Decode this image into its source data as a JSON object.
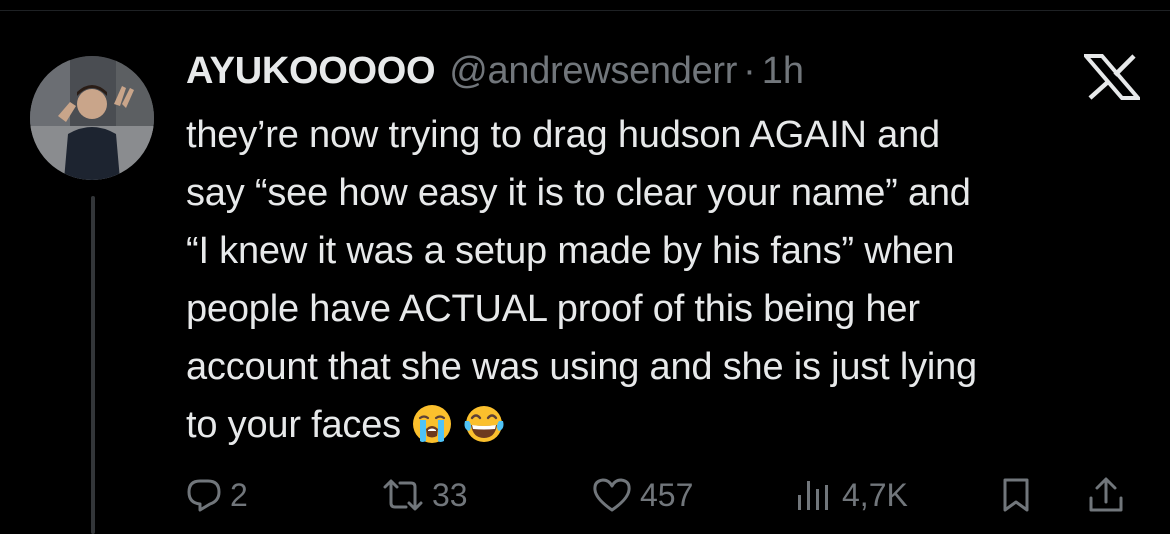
{
  "tweet": {
    "display_name": "AYUKOOOOO",
    "handle": "@andrewsenderr",
    "separator": "·",
    "timestamp": "1h",
    "lines": [
      "they’re now trying to drag hudson AGAIN and",
      "say “see how easy it is to clear your name” and",
      "“I knew it was a setup made by his fans” when",
      "people have ACTUAL proof of this being her",
      "account that she was using and she is just lying",
      "to your faces"
    ],
    "emojis": [
      "loudly-crying-face-icon",
      "face-with-tears-of-joy-icon"
    ]
  },
  "actions": {
    "replies": "2",
    "reposts": "33",
    "likes": "457",
    "views": "4,7K"
  },
  "colors": {
    "background": "#000000",
    "text_primary": "#e7e9ea",
    "text_secondary": "#71767b",
    "thread_line": "#333639"
  }
}
